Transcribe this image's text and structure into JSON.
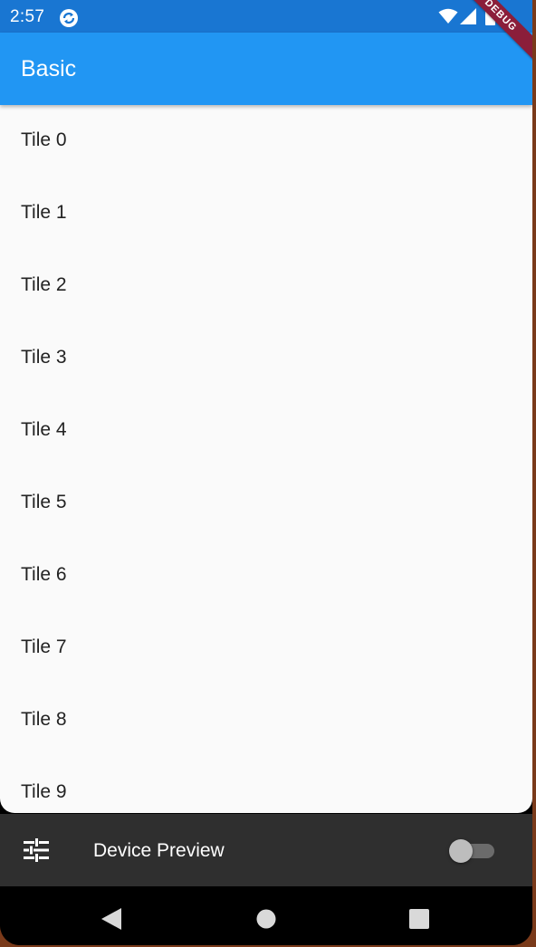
{
  "status_bar": {
    "time": "2:57",
    "icons": [
      "sync-icon",
      "wifi-icon",
      "signal-icon",
      "battery-icon"
    ]
  },
  "debug_banner": {
    "label": "DEBUG"
  },
  "app_bar": {
    "title": "Basic"
  },
  "tiles": [
    {
      "label": "Tile 0"
    },
    {
      "label": "Tile 1"
    },
    {
      "label": "Tile 2"
    },
    {
      "label": "Tile 3"
    },
    {
      "label": "Tile 4"
    },
    {
      "label": "Tile 5"
    },
    {
      "label": "Tile 6"
    },
    {
      "label": "Tile 7"
    },
    {
      "label": "Tile 8"
    },
    {
      "label": "Tile 9"
    }
  ],
  "device_preview": {
    "label": "Device Preview",
    "toggle_on": false,
    "icon": "tune-icon"
  },
  "nav_bar": {
    "icons": [
      "back-icon",
      "home-icon",
      "recents-icon"
    ]
  },
  "colors": {
    "status_bar": "#1976d2",
    "app_bar": "#2196f3",
    "list_background": "#fafafa",
    "preview_bar": "#2f2f2f",
    "debug_banner": "#8b1e3a"
  }
}
